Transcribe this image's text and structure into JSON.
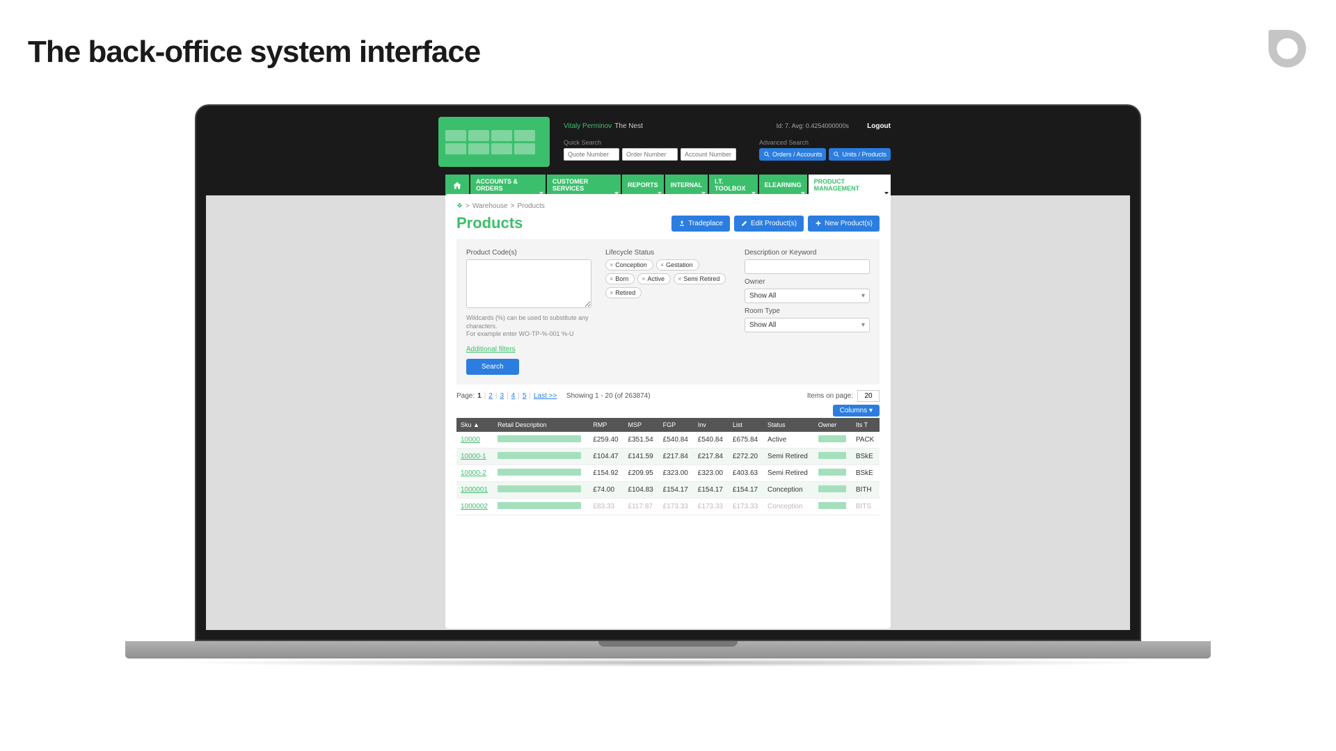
{
  "slide": {
    "title": "The back-office system interface"
  },
  "topbar": {
    "user_name": "Vitaly Perminov",
    "location": "The Nest",
    "stats": "Id: 7. Avg: 0.4254000000s",
    "logout": "Logout",
    "quick_search_label": "Quick Search",
    "quote_ph": "Quote Number",
    "order_ph": "Order Number",
    "account_ph": "Account Number",
    "adv_search_label": "Advanced Search",
    "orders_btn": "Orders / Accounts",
    "units_btn": "Units / Products"
  },
  "nav": {
    "items": [
      {
        "label": "ACCOUNTS & ORDERS"
      },
      {
        "label": "CUSTOMER SERVICES"
      },
      {
        "label": "REPORTS"
      },
      {
        "label": "INTERNAL"
      },
      {
        "label": "I.T. TOOLBOX"
      },
      {
        "label": "ELEARNING"
      },
      {
        "label": "PRODUCT MANAGEMENT"
      }
    ]
  },
  "breadcrumb": {
    "a": "Warehouse",
    "b": "Products",
    "sep": ">"
  },
  "page": {
    "title": "Products"
  },
  "actions": {
    "tradeplace": "Tradeplace",
    "edit": "Edit Product(s)",
    "newp": "New Product(s)"
  },
  "filters": {
    "codes_label": "Product Code(s)",
    "status_label": "Lifecycle Status",
    "statuses": [
      "Conception",
      "Gestation",
      "Born",
      "Active",
      "Semi Retired",
      "Retired"
    ],
    "desc_label": "Description or Keyword",
    "owner_label": "Owner",
    "owner_value": "Show All",
    "room_label": "Room Type",
    "room_value": "Show All",
    "hint1": "Wildcards (%) can be used to substitute any characters.",
    "hint2": "For example enter WO-TP-%-001 %-U",
    "additional": "Additional filters",
    "search": "Search"
  },
  "pager": {
    "page_label": "Page:",
    "pages": [
      "1",
      "2",
      "3",
      "4",
      "5"
    ],
    "last": "Last >>",
    "showing": "Showing 1 - 20 (of 263874)",
    "items_label": "Items on page:",
    "items_value": "20",
    "columns": "Columns ▾"
  },
  "table": {
    "headers": [
      "Sku ▲",
      "Retail Description",
      "RMP",
      "MSP",
      "FGP",
      "Inv",
      "List",
      "Status",
      "Owner",
      "Its T"
    ],
    "rows": [
      {
        "sku": "10000",
        "rmp": "£259.40",
        "msp": "£351.54",
        "fgp": "£540.84",
        "inv": "£540.84",
        "list": "£675.84",
        "status": "Active",
        "its": "PACK"
      },
      {
        "sku": "10000-1",
        "rmp": "£104.47",
        "msp": "£141.59",
        "fgp": "£217.84",
        "inv": "£217.84",
        "list": "£272.20",
        "status": "Semi Retired",
        "its": "BSkE"
      },
      {
        "sku": "10000-2",
        "rmp": "£154.92",
        "msp": "£209.95",
        "fgp": "£323.00",
        "inv": "£323.00",
        "list": "£403.63",
        "status": "Semi Retired",
        "its": "BSkE"
      },
      {
        "sku": "1000001",
        "rmp": "£74.00",
        "msp": "£104.83",
        "fgp": "£154.17",
        "inv": "£154.17",
        "list": "£154.17",
        "status": "Conception",
        "its": "BITH"
      },
      {
        "sku": "1000002",
        "rmp": "£83.33",
        "msp": "£117.87",
        "fgp": "£173.33",
        "inv": "£173.33",
        "list": "£173.33",
        "status": "Conception",
        "its": "BITS"
      }
    ]
  }
}
